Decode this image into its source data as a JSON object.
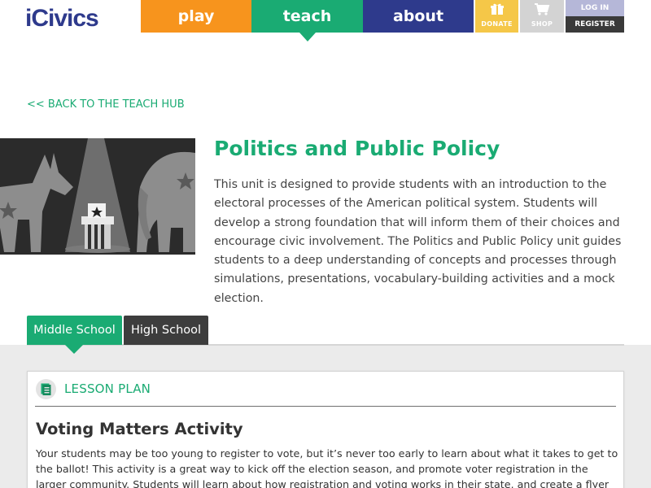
{
  "header": {
    "logo_text": "iCivics",
    "nav": {
      "play": "play",
      "teach": "teach",
      "about": "about"
    },
    "util": {
      "donate": "DONATE",
      "shop": "SHOP",
      "login": "LOG IN",
      "register": "REGISTER"
    },
    "icons": {
      "donate": "gift-icon",
      "shop": "cart-icon"
    }
  },
  "back_link": "<< BACK TO THE TEACH HUB",
  "unit": {
    "title": "Politics and Public Policy",
    "description": "This unit is designed to provide students with an introduction to the electoral processes of the American political system. Students will develop a strong foundation that will inform them of their choices and encourage civic involvement. The Politics and Public Policy unit guides students to a deep understanding of concepts and processes through simulations, presentations, vocabulary-building activities and a mock election."
  },
  "tabs": [
    {
      "label": "Middle School",
      "active": true
    },
    {
      "label": "High School",
      "active": false
    }
  ],
  "lesson": {
    "type_label": "LESSON PLAN",
    "title": "Voting Matters Activity",
    "description": "Your students may be too young to register to vote, but it’s never too early to learn about what it takes to get to the ballot!  This activity is a great way to kick off the election season, and promote voter registration in the larger community.  Students will learn about how registration and voting works in their state, and create a flyer to share with"
  },
  "colors": {
    "green": "#1aab73",
    "orange": "#f7941d",
    "navy": "#2e3a8c",
    "yellow": "#f5c748",
    "dark": "#3d3d3d"
  }
}
